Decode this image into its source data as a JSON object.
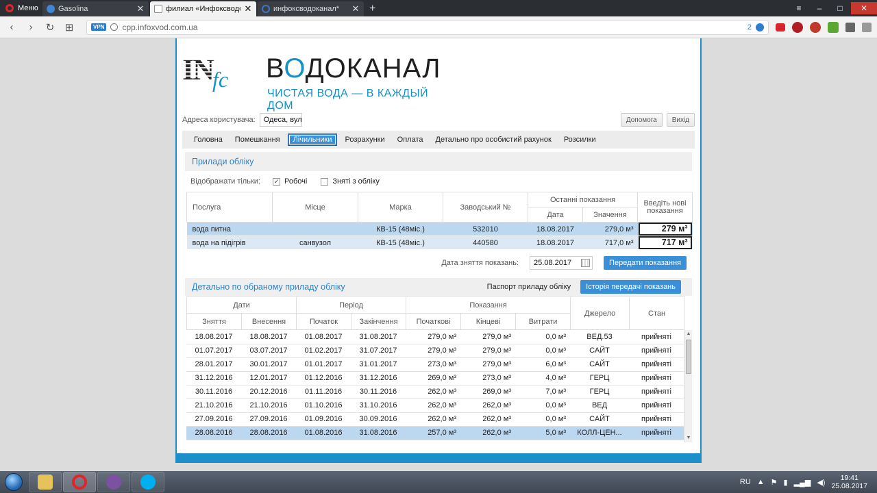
{
  "browser": {
    "menu_label": "Меню",
    "tabs": [
      {
        "title": "Gasolina",
        "close": "✕"
      },
      {
        "title": "филиал «Инфоксводоканал»",
        "close": "✕"
      },
      {
        "title": "инфоксводоканал*",
        "close": "✕"
      }
    ],
    "new_tab": "+",
    "url": "cpp.infoxvod.com.ua",
    "vpn_label": "VPN",
    "tracker_count": "2"
  },
  "site": {
    "logo_in": "IN",
    "logo_fc": "fc",
    "brand_prefix": "В",
    "brand_drop": "О",
    "brand_rest": "ДОКАНАЛ",
    "slogan": "ЧИСТАЯ ВОДА — В КАЖДЫЙ ДОМ"
  },
  "userbar": {
    "address_label": "Адреса користувача:",
    "address_value": "Одеса, вул.",
    "help": "Допомога",
    "logout": "Вихід"
  },
  "menu": [
    "Головна",
    "Помешкання",
    "Лічильники",
    "Розрахунки",
    "Оплата",
    "Детально про особистий рахунок",
    "Розсилки"
  ],
  "meters": {
    "title": "Прилади обліку",
    "filter_label": "Відображати тільки:",
    "filter_working": "Робочі",
    "filter_removed": "Зняті з обліку",
    "headers": {
      "service": "Послуга",
      "place": "Місце",
      "brand": "Марка",
      "serial": "Заводський №",
      "last": "Останні показання",
      "date": "Дата",
      "value": "Значення",
      "new": "Введіть нові показання"
    },
    "rows": [
      {
        "service": "вода питна",
        "place": "",
        "brand": "КВ-15 (48міс.)",
        "serial": "532010",
        "date": "18.08.2017",
        "value": "279,0 м³",
        "new": "279 м³"
      },
      {
        "service": "вода на підігрів",
        "place": "санвузол",
        "brand": "КВ-15 (48міс.)",
        "serial": "440580",
        "date": "18.08.2017",
        "value": "717,0 м³",
        "new": "717 м³"
      }
    ],
    "removal_date_label": "Дата зняття показань:",
    "removal_date": "25.08.2017",
    "submit": "Передати показання"
  },
  "history": {
    "title": "Детально по обраному приладу обліку",
    "passport": "Паспорт приладу обліку",
    "history_button": "Історія передачі показань",
    "groups": {
      "dates": "Дати",
      "period": "Період",
      "readings": "Показання",
      "source": "Джерело",
      "state": "Стан"
    },
    "cols": {
      "taken": "Зняття",
      "entered": "Внесення",
      "start": "Початок",
      "end": "Закінчення",
      "initial": "Початкові",
      "final": "Кінцеві",
      "usage": "Витрати"
    },
    "rows": [
      [
        "18.08.2017",
        "18.08.2017",
        "01.08.2017",
        "31.08.2017",
        "279,0 м³",
        "279,0 м³",
        "0,0 м³",
        "ВЕД.53",
        "прийняті"
      ],
      [
        "01.07.2017",
        "03.07.2017",
        "01.02.2017",
        "31.07.2017",
        "279,0 м³",
        "279,0 м³",
        "0,0 м³",
        "САЙТ",
        "прийняті"
      ],
      [
        "28.01.2017",
        "30.01.2017",
        "01.01.2017",
        "31.01.2017",
        "273,0 м³",
        "279,0 м³",
        "6,0 м³",
        "САЙТ",
        "прийняті"
      ],
      [
        "31.12.2016",
        "12.01.2017",
        "01.12.2016",
        "31.12.2016",
        "269,0 м³",
        "273,0 м³",
        "4,0 м³",
        "ГЕРЦ",
        "прийняті"
      ],
      [
        "30.11.2016",
        "20.12.2016",
        "01.11.2016",
        "30.11.2016",
        "262,0 м³",
        "269,0 м³",
        "7,0 м³",
        "ГЕРЦ",
        "прийняті"
      ],
      [
        "21.10.2016",
        "21.10.2016",
        "01.10.2016",
        "31.10.2016",
        "262,0 м³",
        "262,0 м³",
        "0,0 м³",
        "ВЕД",
        "прийняті"
      ],
      [
        "27.09.2016",
        "27.09.2016",
        "01.09.2016",
        "30.09.2016",
        "262,0 м³",
        "262,0 м³",
        "0,0 м³",
        "САЙТ",
        "прийняті"
      ],
      [
        "28.08.2016",
        "28.08.2016",
        "01.08.2016",
        "31.08.2016",
        "257,0 м³",
        "262,0 м³",
        "5,0 м³",
        "КОЛЛ-ЦЕН...",
        "прийняті"
      ]
    ]
  },
  "taskbar": {
    "lang": "RU",
    "time": "19:41",
    "date": "25.08.2017"
  },
  "colors": {
    "accent": "#3a8fd9",
    "border": "#1a8fc9",
    "selected_row": "#bcd8f0"
  }
}
